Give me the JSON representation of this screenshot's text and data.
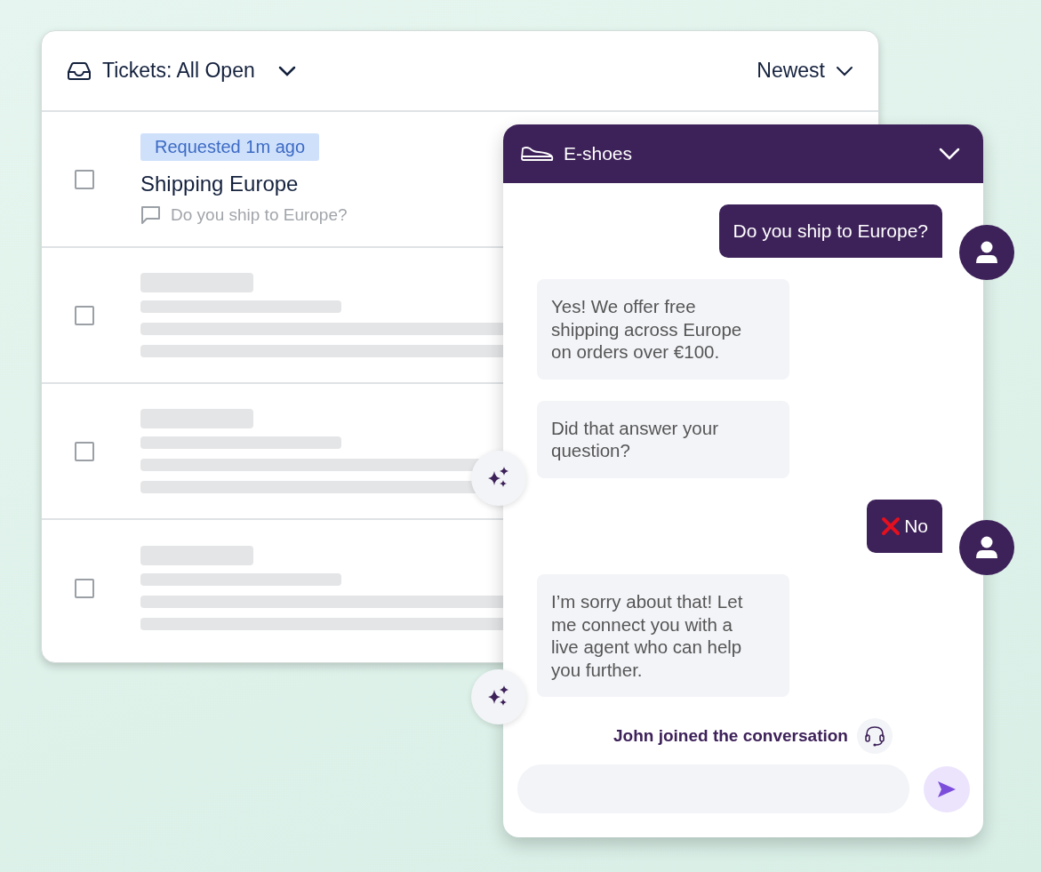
{
  "tickets": {
    "title": "Tickets: All Open",
    "sort": "Newest",
    "rows": [
      {
        "kind": "ticket",
        "checked": false,
        "badge": "Requested 1m ago",
        "subject": "Shipping Europe",
        "preview": "Do you ship to Europe?"
      },
      {
        "kind": "placeholder",
        "checked": false
      },
      {
        "kind": "placeholder",
        "checked": false
      },
      {
        "kind": "placeholder",
        "checked": false
      }
    ]
  },
  "chat": {
    "title": "E-shoes",
    "messages": [
      {
        "kind": "user",
        "text": "Do you ship to Europe?"
      },
      {
        "kind": "bot",
        "text": "Yes! We offer free shipping across Europe on orders over €100.",
        "sparkle": false
      },
      {
        "kind": "bot",
        "text": "Did that answer your question?",
        "sparkle": true
      },
      {
        "kind": "user_no",
        "text": "No"
      },
      {
        "kind": "bot",
        "text": "I’m sorry about that! Let me connect you with a live agent who can help you further.",
        "sparkle": true
      },
      {
        "kind": "event",
        "text": "John joined the conversation"
      }
    ]
  }
}
